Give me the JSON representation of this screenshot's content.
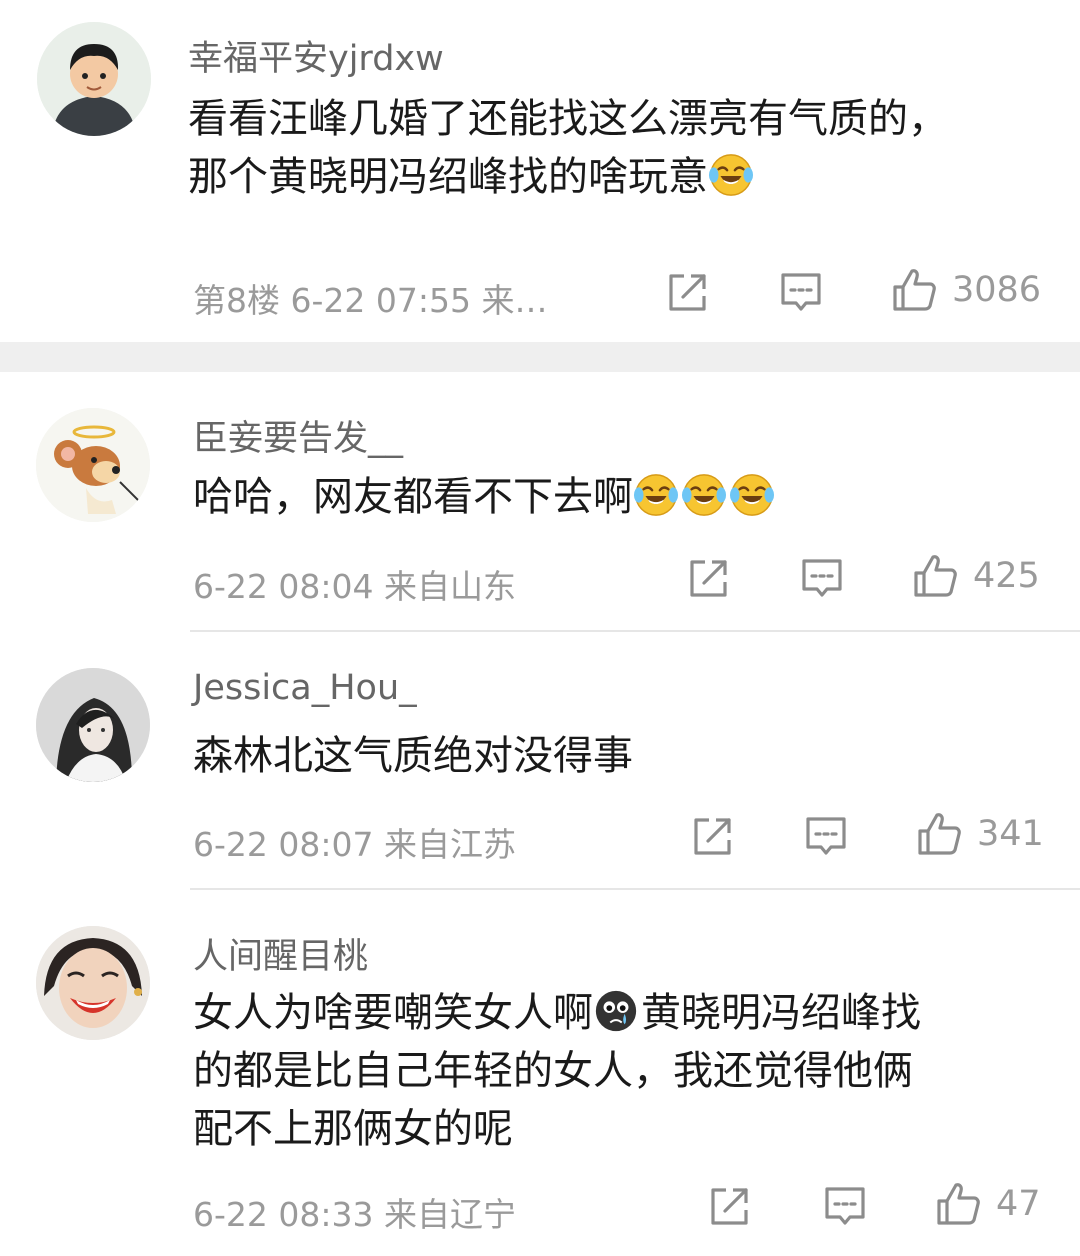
{
  "comments": [
    {
      "username": "幸福平安yjrdxw",
      "text_lines": [
        "看看汪峰几婚了还能找这么漂亮有气质的，",
        "那个黄晓明冯绍峰找的啥玩意"
      ],
      "meta": "第8楼  6-22 07:55  来…",
      "likes": "3086",
      "avatar_icon": "cartoon-boy-avatar"
    },
    {
      "username": "臣妾要告发__",
      "text_lines": [
        "哈哈，网友都看不下去啊"
      ],
      "meta": "6-22 08:04  来自山东",
      "likes": "425",
      "avatar_icon": "cartoon-mouse-angel-avatar"
    },
    {
      "username": "Jessica_Hou_",
      "text_lines": [
        "森林北这气质绝对没得事"
      ],
      "meta": "6-22 08:07  来自江苏",
      "likes": "341",
      "avatar_icon": "bw-woman-photo-avatar"
    },
    {
      "username": "人间醒目桃",
      "text_lines": [
        "女人为啥要嘲笑女人啊",
        "黄晓明冯绍峰找",
        "的都是比自己年轻的女人，我还觉得他俩",
        "配不上那俩女的呢"
      ],
      "meta": "6-22 08:33  来自辽宁",
      "likes": "47",
      "avatar_icon": "smiling-woman-avatar"
    }
  ],
  "emojis": {
    "laugh_cry": "laugh-cry-emoji",
    "black_cry": "black-face-crying-emoji"
  },
  "colors": {
    "text": "#1a1a1a",
    "username": "#666666",
    "meta": "#9a9a9a",
    "separator_band": "#efefef",
    "emoji_yellow": "#f7c531"
  }
}
